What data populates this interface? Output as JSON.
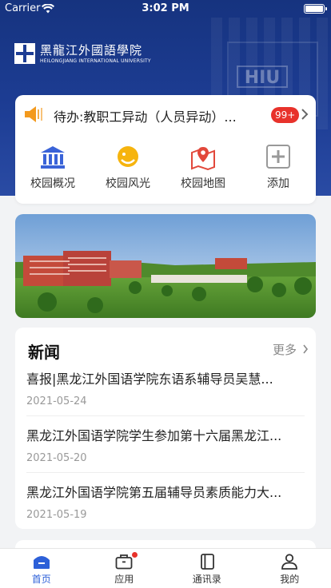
{
  "status_bar": {
    "carrier": "Carrier",
    "time": "3:02 PM"
  },
  "header": {
    "logo_cn": "黑龍江外國語學院",
    "logo_en": "HEILONGJIANG INTERNATIONAL UNIVERSITY",
    "watermark": "HIU"
  },
  "notice": {
    "text": "待办:教职工异动（人员异动）...",
    "badge": "99+"
  },
  "quick_actions": [
    {
      "label": "校园概况",
      "icon": "building-icon"
    },
    {
      "label": "校园风光",
      "icon": "sun-icon"
    },
    {
      "label": "校园地图",
      "icon": "map-pin-icon"
    },
    {
      "label": "添加",
      "icon": "add-icon"
    }
  ],
  "news": {
    "title": "新闻",
    "more": "更多",
    "items": [
      {
        "headline": "喜报|黑龙江外国语学院东语系辅导员吴慧...",
        "date": "2021-05-24"
      },
      {
        "headline": "黑龙江外国语学院学生参加第十六届黑龙江...",
        "date": "2021-05-20"
      },
      {
        "headline": "黑龙江外国语学院第五届辅导员素质能力大...",
        "date": "2021-05-19"
      }
    ]
  },
  "tabbar": [
    {
      "label": "首页",
      "icon": "home-icon",
      "active": true
    },
    {
      "label": "应用",
      "icon": "briefcase-icon",
      "active": false
    },
    {
      "label": "通讯录",
      "icon": "contacts-icon",
      "active": false
    },
    {
      "label": "我的",
      "icon": "user-icon",
      "active": false
    }
  ],
  "colors": {
    "header": "#1d3d94",
    "accent": "#2d60d8",
    "badge": "#e8322b",
    "speaker": "#f39a1e"
  }
}
